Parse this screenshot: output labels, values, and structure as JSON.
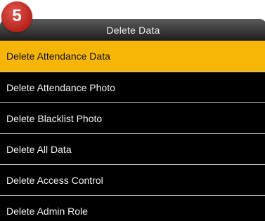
{
  "badge": {
    "step": "5"
  },
  "header": {
    "title": "Delete Data"
  },
  "menu": {
    "items": [
      {
        "label": "Delete Attendance Data",
        "selected": true
      },
      {
        "label": "Delete Attendance Photo",
        "selected": false
      },
      {
        "label": "Delete Blacklist Photo",
        "selected": false
      },
      {
        "label": "Delete All Data",
        "selected": false
      },
      {
        "label": "Delete Access Control",
        "selected": false
      },
      {
        "label": "Delete Admin Role",
        "selected": false
      }
    ]
  },
  "colors": {
    "selected_background": "#f7b505",
    "screen_background": "#000000",
    "badge": "#c0281f"
  }
}
